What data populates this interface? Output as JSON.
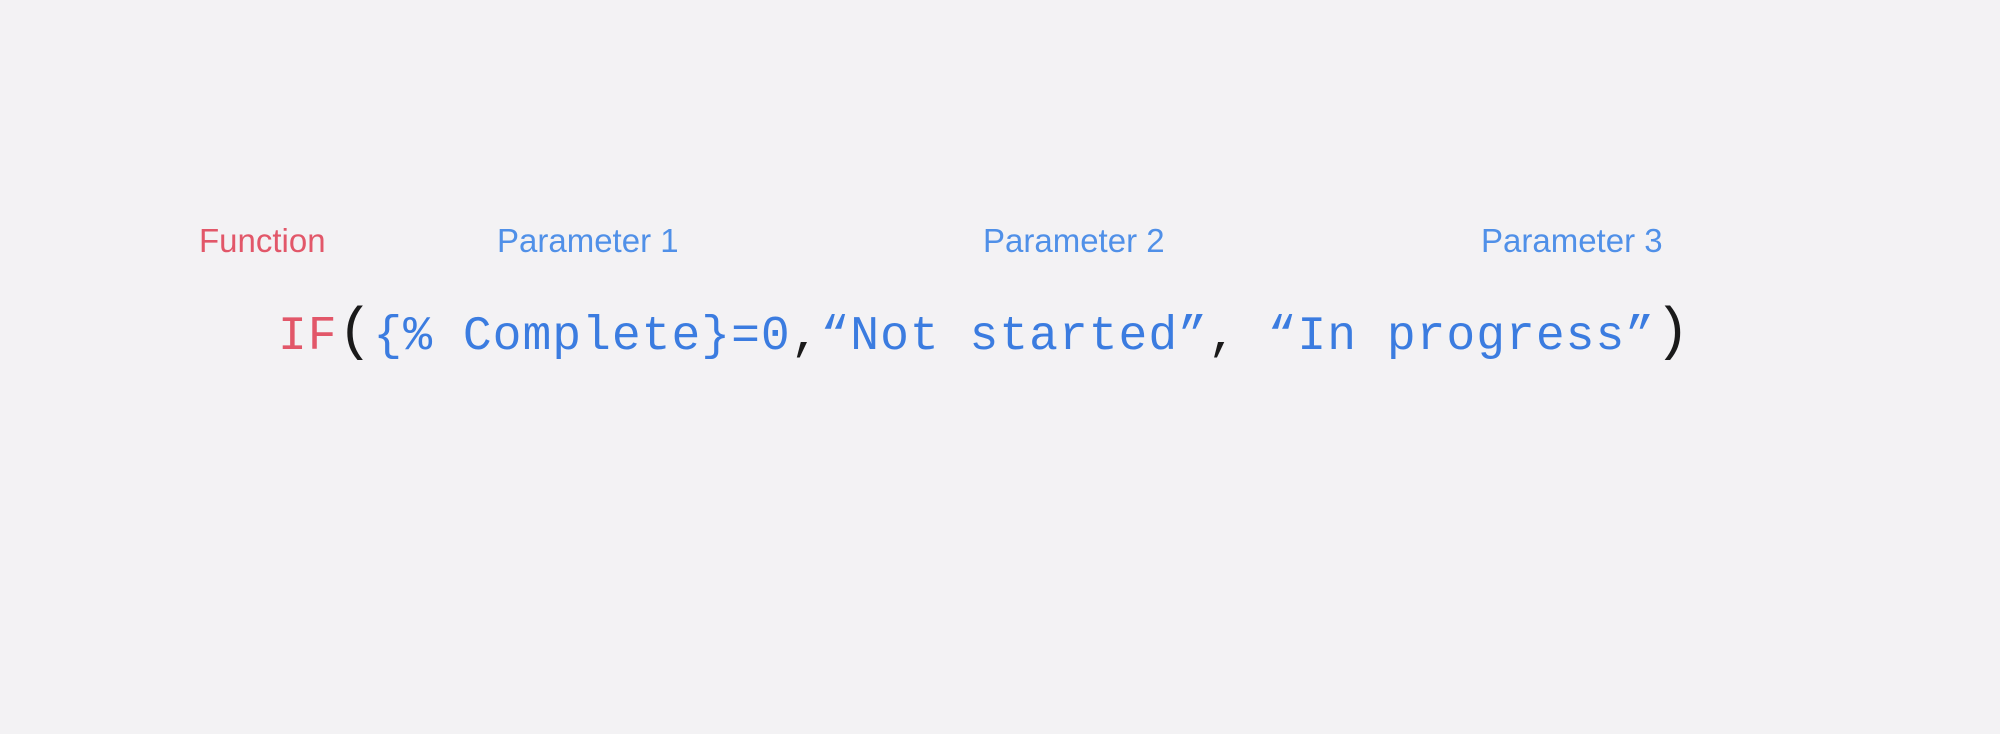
{
  "labels": {
    "function": "Function",
    "param1": "Parameter 1",
    "param2": "Parameter 2",
    "param3": "Parameter 3"
  },
  "formula": {
    "func": "IF",
    "open_paren": "(",
    "param1": "{% Complete}=0",
    "comma1": ",",
    "param2": "“Not started”",
    "comma2": ",",
    "space": " ",
    "param3": "“In progress”",
    "close_paren": ")"
  }
}
